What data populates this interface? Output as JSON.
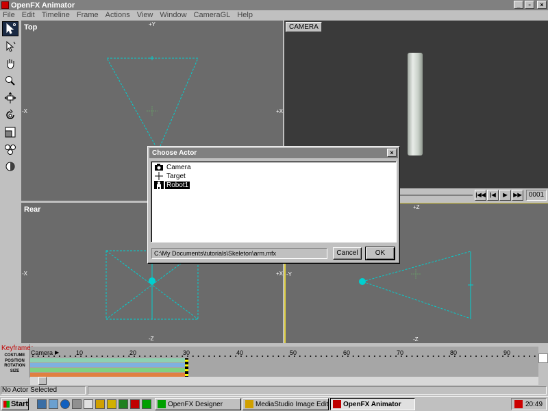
{
  "window": {
    "title": "OpenFX Animator",
    "min": "_",
    "max": "▫",
    "close": "×"
  },
  "menu": [
    "File",
    "Edit",
    "Timeline",
    "Frame",
    "Actions",
    "View",
    "Window",
    "CameraGL",
    "Help"
  ],
  "tools": [
    "pointer-icon",
    "select-icon",
    "pan-hand-icon",
    "zoom-icon",
    "move-icon",
    "rotate-icon",
    "scale-icon",
    "group-icon",
    "sphere-icon"
  ],
  "viewports": {
    "top": {
      "label": "Top",
      "axis_top": "+Y",
      "axis_left": "-X",
      "axis_right": "+X"
    },
    "camera": {
      "label": "CAMERA"
    },
    "rear": {
      "label": "Rear",
      "axis_left": "-X",
      "axis_right": "+X",
      "axis_bottom": "-Z"
    },
    "side": {
      "axis_top": "+Z",
      "axis_left": "-Y",
      "axis_bottom": "-Z"
    }
  },
  "frame_controls": {
    "buttons": [
      "|◀◀",
      "|◀",
      "▶",
      "▶▶"
    ],
    "frame_number": "0001"
  },
  "keyframer": {
    "title": "Keyframer",
    "rows": [
      "COSTUME",
      "POSITION",
      "ROTATION",
      "SIZE"
    ],
    "actor": "Camera",
    "ticks": [
      "10",
      "20",
      "30",
      "40",
      "50",
      "60",
      "70",
      "80",
      "90"
    ],
    "track_colors": [
      "#8fd0b0",
      "#7fb0e0",
      "#80d080",
      "#e08040"
    ]
  },
  "status": {
    "text": "No Actor Selected"
  },
  "taskbar": {
    "start": "Start",
    "tasks": [
      "OpenFX Designer",
      "MediaStudio Image Editor",
      "OpenFX Animator"
    ],
    "clock": "20:49"
  },
  "dialog": {
    "title": "Choose Actor",
    "close": "×",
    "items": [
      {
        "label": "Camera",
        "icon": "camera-icon"
      },
      {
        "label": "Target",
        "icon": "target-icon"
      },
      {
        "label": "Robot1",
        "icon": "robot-icon"
      }
    ],
    "path": "C:\\My Documents\\tutorials\\Skeleton\\arm.mfx",
    "cancel": "Cancel",
    "ok": "OK"
  }
}
